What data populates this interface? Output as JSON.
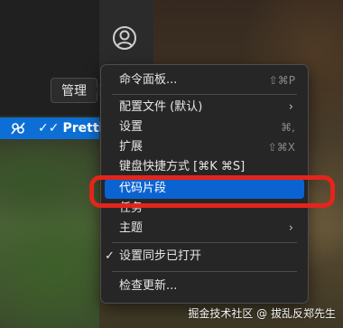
{
  "tooltip": {
    "text": "管理"
  },
  "statusbar": {
    "prettier_label": "Prettie"
  },
  "menu": {
    "items": [
      {
        "label": "命令面板...",
        "shortcut": "⇧⌘P"
      },
      {
        "label": "配置文件 (默认)",
        "submenu": true
      },
      {
        "label": "设置",
        "shortcut": "⌘,"
      },
      {
        "label": "扩展",
        "shortcut": "⇧⌘X"
      },
      {
        "label": "键盘快捷方式 [⌘K ⌘S]"
      },
      {
        "label": "代码片段",
        "selected": true
      },
      {
        "label": "任务"
      },
      {
        "label": "主题",
        "submenu": true
      },
      {
        "label": "设置同步已打开",
        "checked": true
      },
      {
        "label": "检查更新..."
      }
    ]
  },
  "watermark": {
    "text": "掘金技术社区 @ 拔乱反郑先生"
  },
  "icons": {
    "account": "account-icon",
    "remote": "remote-connection-icon",
    "prettier_check": "double-check-icon",
    "submenu": "chevron-right-icon",
    "checked": "checkmark-icon"
  },
  "colors": {
    "selection": "#0b63d1",
    "statusbar": "#0d6fd6",
    "highlight": "#e3251b"
  }
}
